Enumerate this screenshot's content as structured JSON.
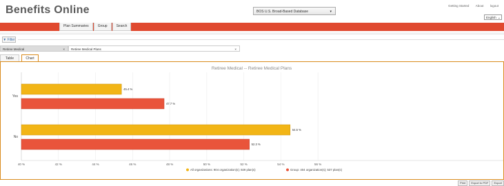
{
  "app": {
    "title": "Benefits Online"
  },
  "database_select": {
    "value": "BOS U.S. Broad-Based Database"
  },
  "top_links": [
    "Getting Started",
    "About",
    "logout"
  ],
  "language_select": {
    "value": "English"
  },
  "nav_tabs": [
    "Plan Summaries",
    "Group",
    "Search"
  ],
  "filter": {
    "label": "Filter"
  },
  "filters": {
    "filter1": "Retiree Medical",
    "filter2": "Retiree Medical Plans"
  },
  "view_tabs": [
    "Table",
    "Chart"
  ],
  "bottom_buttons": [
    "Print",
    "Export to PDF",
    "Export"
  ],
  "colors": {
    "brand_red": "#e0492f",
    "accent_orange": "#d98b1c",
    "series_all": "#f2b516",
    "series_group": "#e9543b"
  },
  "chart_data": {
    "type": "bar",
    "orientation": "horizontal",
    "title": "Retiree Medical -- Retiree Medical Plans",
    "categories": [
      "Yes",
      "No"
    ],
    "xlim": [
      40,
      66
    ],
    "x_ticks": [
      "40 %",
      "42 %",
      "44 %",
      "46 %",
      "48 %",
      "50 %",
      "52 %",
      "54 %",
      "56 %"
    ],
    "tick_values": [
      40,
      42,
      44,
      46,
      48,
      50,
      52,
      54,
      56
    ],
    "series": [
      {
        "name": "All organizations: 904 organization(s); 929 plan(s)",
        "values": [
          45.4,
          54.5
        ],
        "labels": [
          "45.4 %",
          "54.5 %"
        ]
      },
      {
        "name": "Group: 404 organization(s); 537 plan(s)",
        "values": [
          47.7,
          52.3
        ],
        "labels": [
          "47.7 %",
          "52.3 %"
        ]
      }
    ],
    "grid": true,
    "legend_position": "bottom"
  }
}
